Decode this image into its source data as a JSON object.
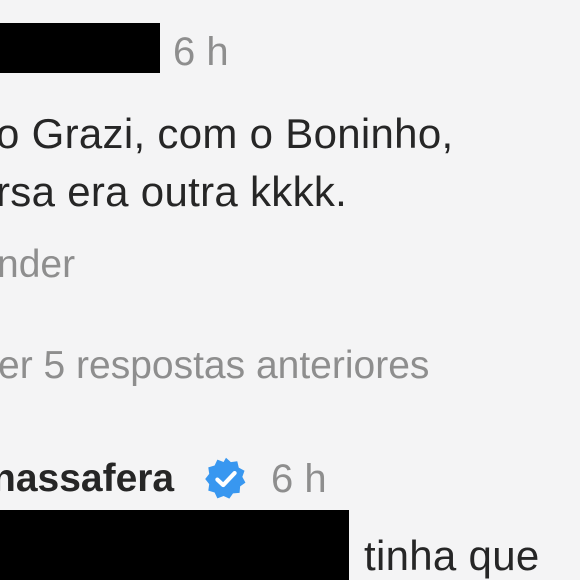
{
  "comment1": {
    "time": "6 h",
    "text_line1": "o Grazi,  com o Boninho,",
    "text_line2": "rsa era outra kkkk.",
    "reply_label": "nder"
  },
  "replies": {
    "view_previous_label": "er 5 respostas anteriores"
  },
  "comment2": {
    "username": "nassafera",
    "verified_icon": "verified-badge-icon",
    "time": "6 h",
    "text_partial": "tinha que"
  },
  "colors": {
    "background": "#f4f4f5",
    "text": "#262626",
    "muted": "#8e8e8e",
    "verified": "#3897f0",
    "redaction": "#000000"
  }
}
